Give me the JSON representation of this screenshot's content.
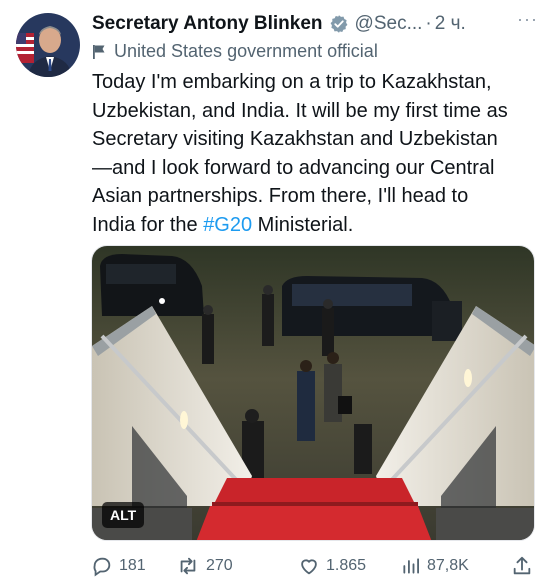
{
  "author": {
    "display_name": "Secretary Antony Blinken",
    "handle": "@Sec...",
    "separator": "·",
    "time": "2 ч.",
    "affiliation": "United States government official",
    "avatar": "avatar-portrait",
    "verified_icon": "verified-badge-icon"
  },
  "tweet": {
    "lines": [
      "Today I'm embarking on a trip to Kazakhstan,",
      "Uzbekistan, and India. It will be my first time as",
      "Secretary visiting Kazakhstan and Uzbekistan",
      "—and I look forward to advancing our Central",
      "Asian partnerships. From there, I'll head to"
    ],
    "last_line_before": "India for the ",
    "hashtag": "#G20",
    "last_line_after": " Ministerial."
  },
  "media": {
    "alt_label": "ALT"
  },
  "more_icon": "···",
  "actions": {
    "replies": "181",
    "reposts": "270",
    "likes": "1.865",
    "views": "87,8K"
  },
  "colors": {
    "accent": "#1d9bf0",
    "muted": "#536471",
    "text": "#0f1419"
  }
}
